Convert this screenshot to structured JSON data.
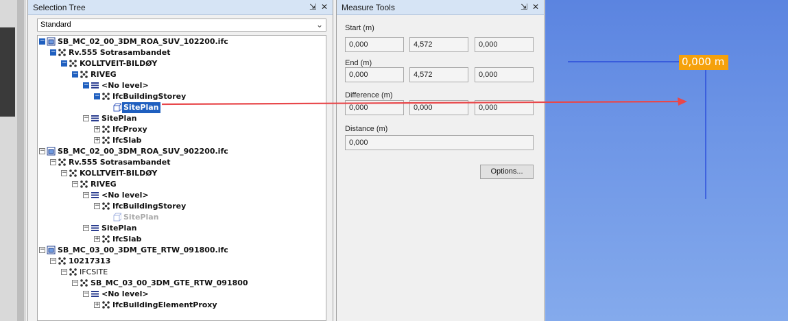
{
  "selection_tree": {
    "title": "Selection Tree",
    "view_selected": "Standard",
    "items": [
      {
        "label": "SB_MC_02_00_3DM_ROA_SUV_102200.ifc",
        "depth": 0,
        "exp": "−",
        "icon": "ifc-file-icon",
        "state": "sel-path"
      },
      {
        "label": "Rv.555 Sotrasambandet",
        "depth": 1,
        "exp": "−",
        "icon": "ifc-node-icon",
        "state": "sel-path"
      },
      {
        "label": "KOLLTVEIT-BILDØY",
        "depth": 2,
        "exp": "−",
        "icon": "ifc-node-icon",
        "state": "sel-path"
      },
      {
        "label": "RIVEG",
        "depth": 3,
        "exp": "−",
        "icon": "ifc-node-icon",
        "state": "sel-path"
      },
      {
        "label": "<No level>",
        "depth": 4,
        "exp": "−",
        "icon": "level-stack-icon",
        "state": "sel-path"
      },
      {
        "label": "IfcBuildingStorey",
        "depth": 5,
        "exp": "−",
        "icon": "ifc-node-icon",
        "state": "sel-path"
      },
      {
        "label": "SitePlan",
        "depth": 6,
        "exp": "",
        "icon": "geometry-cube-icon",
        "state": "selected"
      },
      {
        "label": "SitePlan",
        "depth": 4,
        "exp": "−",
        "icon": "level-stack-icon",
        "state": ""
      },
      {
        "label": "IfcProxy",
        "depth": 5,
        "exp": "+",
        "icon": "ifc-node-icon",
        "state": ""
      },
      {
        "label": "IfcSlab",
        "depth": 5,
        "exp": "+",
        "icon": "ifc-node-icon",
        "state": ""
      },
      {
        "label": "SB_MC_02_00_3DM_ROA_SUV_902200.ifc",
        "depth": 0,
        "exp": "−",
        "icon": "ifc-file-icon",
        "state": ""
      },
      {
        "label": "Rv.555 Sotrasambandet",
        "depth": 1,
        "exp": "−",
        "icon": "ifc-node-icon",
        "state": ""
      },
      {
        "label": "KOLLTVEIT-BILDØY",
        "depth": 2,
        "exp": "−",
        "icon": "ifc-node-icon",
        "state": ""
      },
      {
        "label": "RIVEG",
        "depth": 3,
        "exp": "−",
        "icon": "ifc-node-icon",
        "state": ""
      },
      {
        "label": "<No level>",
        "depth": 4,
        "exp": "−",
        "icon": "level-stack-icon",
        "state": ""
      },
      {
        "label": "IfcBuildingStorey",
        "depth": 5,
        "exp": "−",
        "icon": "ifc-node-icon",
        "state": ""
      },
      {
        "label": "SitePlan",
        "depth": 6,
        "exp": "",
        "icon": "geometry-cube-icon",
        "state": "hidden"
      },
      {
        "label": "SitePlan",
        "depth": 4,
        "exp": "−",
        "icon": "level-stack-icon",
        "state": ""
      },
      {
        "label": "IfcSlab",
        "depth": 5,
        "exp": "+",
        "icon": "ifc-node-icon",
        "state": ""
      },
      {
        "label": "SB_MC_03_00_3DM_GTE_RTW_091800.ifc",
        "depth": 0,
        "exp": "−",
        "icon": "ifc-file-icon",
        "state": ""
      },
      {
        "label": "10217313",
        "depth": 1,
        "exp": "−",
        "icon": "ifc-node-icon",
        "state": ""
      },
      {
        "label": "IFCSITE",
        "depth": 2,
        "exp": "−",
        "icon": "ifc-node-icon",
        "state": "plain"
      },
      {
        "label": "SB_MC_03_00_3DM_GTE_RTW_091800",
        "depth": 3,
        "exp": "−",
        "icon": "ifc-node-icon",
        "state": ""
      },
      {
        "label": "<No level>",
        "depth": 4,
        "exp": "−",
        "icon": "level-stack-icon",
        "state": ""
      },
      {
        "label": "IfcBuildingElementProxy",
        "depth": 5,
        "exp": "+",
        "icon": "ifc-node-icon",
        "state": ""
      }
    ]
  },
  "measure_tools": {
    "title": "Measure Tools",
    "start_label": "Start (m)",
    "start": [
      "0,000",
      "4,572",
      "0,000"
    ],
    "end_label": "End (m)",
    "end": [
      "0,000",
      "4,572",
      "0,000"
    ],
    "difference_label": "Difference (m)",
    "difference": [
      "0,000",
      "0,000",
      "0,000"
    ],
    "distance_label": "Distance (m)",
    "distance": "0,000",
    "options_label": "Options..."
  },
  "viewport": {
    "measure_label": "0,000 m"
  },
  "colors": {
    "selection": "#1f5fbf",
    "annotation_arrow": "#e8474a",
    "measure_label_bg": "#f5a10b",
    "measure_line": "#1e3fd8"
  }
}
